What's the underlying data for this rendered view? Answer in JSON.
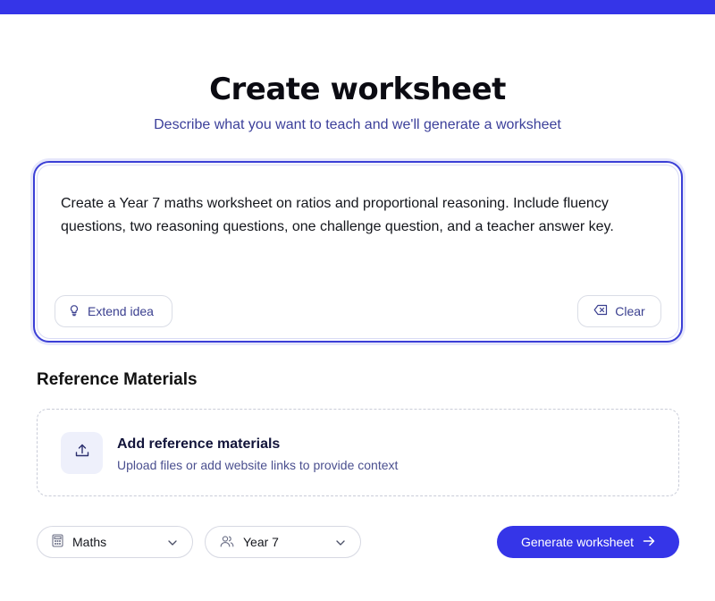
{
  "header": {
    "title": "Create worksheet",
    "subtitle": "Describe what you want to teach and we'll generate a worksheet"
  },
  "prompt": {
    "text": "Create a Year 7 maths worksheet on ratios and proportional reasoning. Include fluency questions, two reasoning questions, one challenge question, and a teacher answer key.",
    "extend_label": "Extend idea",
    "clear_label": "Clear"
  },
  "reference": {
    "heading": "Reference Materials",
    "title": "Add reference materials",
    "subtitle": "Upload files or add website links to provide context"
  },
  "controls": {
    "subject": "Maths",
    "year": "Year 7",
    "generate_label": "Generate worksheet"
  },
  "colors": {
    "accent": "#3535e8",
    "subtitle": "#3b3f9a",
    "upload_tile": "#eef0fb"
  },
  "icons": [
    "lightbulb-icon",
    "backspace-icon",
    "upload-icon",
    "calculator-icon",
    "users-icon",
    "chevron-down-icon",
    "arrow-right-icon"
  ]
}
